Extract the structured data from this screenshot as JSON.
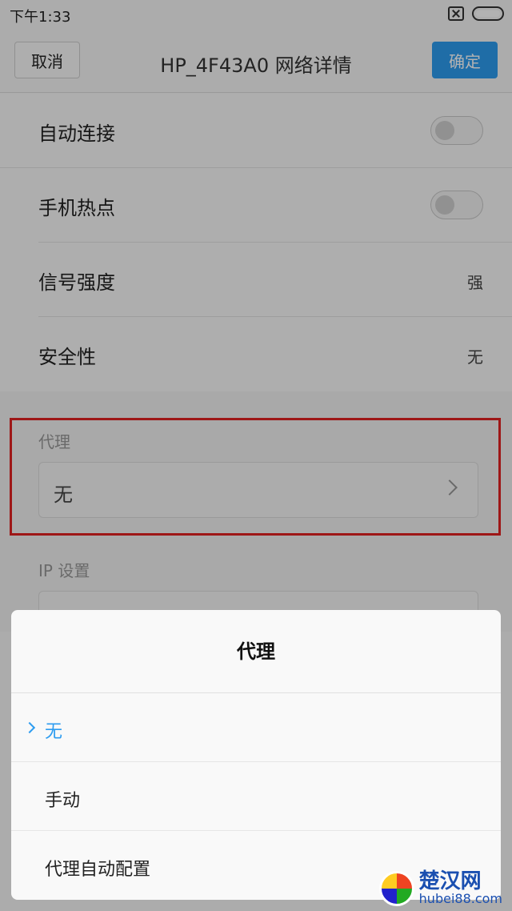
{
  "status_bar": {
    "time": "下午1:33",
    "sim_icon": "no-sim-icon",
    "battery_icon": "battery-icon"
  },
  "header": {
    "cancel": "取消",
    "title": "HP_4F43A0  网络详情",
    "confirm": "确定"
  },
  "settings": {
    "auto_connect": {
      "label": "自动连接",
      "enabled": false
    },
    "hotspot": {
      "label": "手机热点",
      "enabled": false
    },
    "signal": {
      "label": "信号强度",
      "value": "强"
    },
    "security": {
      "label": "安全性",
      "value": "无"
    }
  },
  "proxy": {
    "label": "代理",
    "value": "无"
  },
  "ip_settings": {
    "label": "IP 设置"
  },
  "dialog": {
    "title": "代理",
    "options": [
      {
        "label": "无",
        "selected": true
      },
      {
        "label": "手动",
        "selected": false
      },
      {
        "label": "代理自动配置",
        "selected": false
      }
    ]
  },
  "watermark": {
    "name": "楚汉网",
    "url": "hubei88.com"
  },
  "colors": {
    "accent": "#2d9cf0",
    "highlight_border": "#e32222"
  }
}
